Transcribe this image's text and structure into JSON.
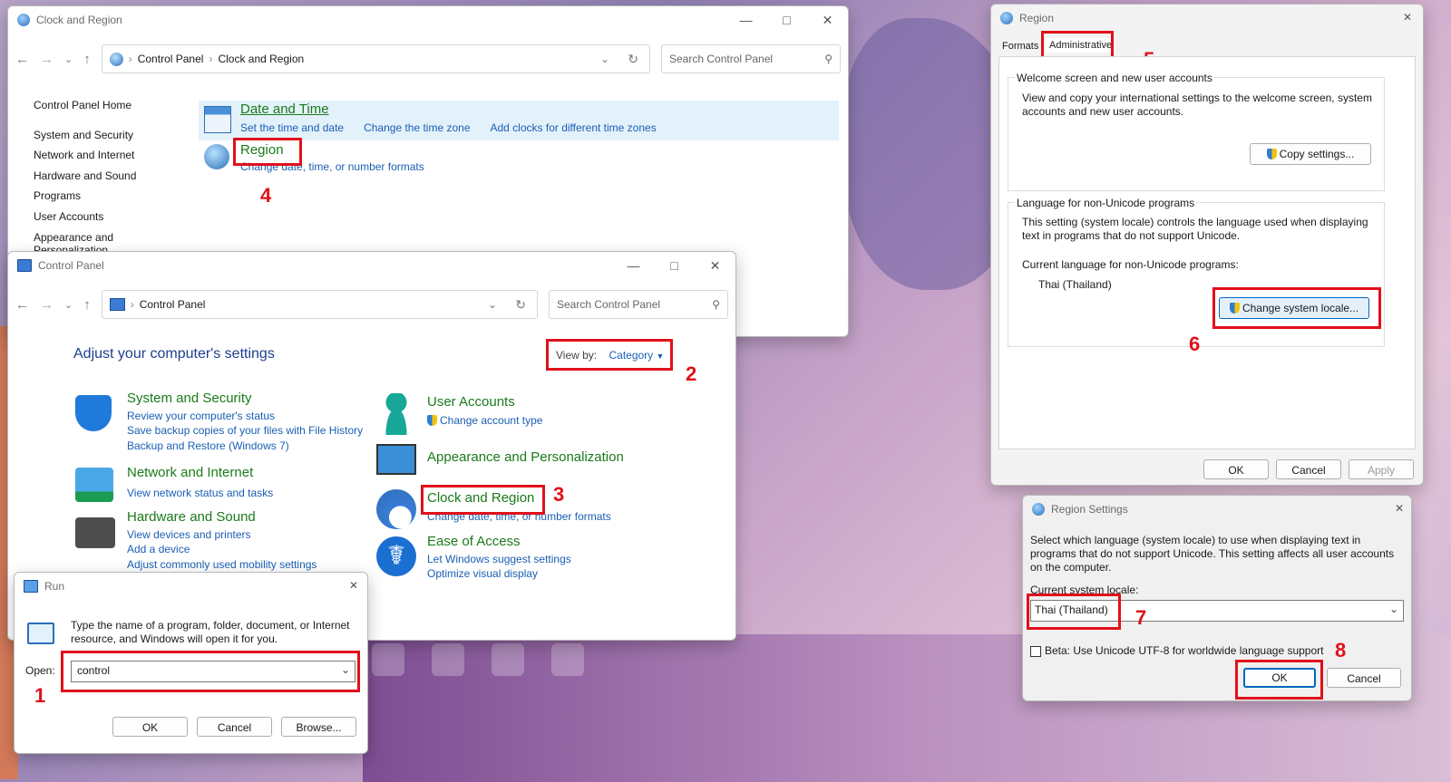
{
  "desktop": {},
  "clock_region_window": {
    "title": "Clock and Region",
    "breadcrumb": [
      "Control Panel",
      "Clock and Region"
    ],
    "search_placeholder": "Search Control Panel",
    "nav": [
      "Control Panel Home",
      "System and Security",
      "Network and Internet",
      "Hardware and Sound",
      "Programs",
      "User Accounts",
      "Appearance and",
      "Personalization"
    ],
    "date_time": {
      "title": "Date and Time",
      "links": [
        "Set the time and date",
        "Change the time zone",
        "Add clocks for different time zones"
      ]
    },
    "region": {
      "title": "Region",
      "link": "Change date, time, or number formats"
    },
    "step": "4"
  },
  "control_panel_window": {
    "title": "Control Panel",
    "breadcrumb": "Control Panel",
    "search_placeholder": "Search Control Panel",
    "heading": "Adjust your computer's settings",
    "view_by_label": "View by:",
    "view_by_value": "Category",
    "step_view": "2",
    "step_clock": "3",
    "left": [
      {
        "title": "System and Security",
        "links": [
          "Review your computer's status",
          "Save backup copies of your files with File History",
          "Backup and Restore (Windows 7)"
        ]
      },
      {
        "title": "Network and Internet",
        "links": [
          "View network status and tasks"
        ]
      },
      {
        "title": "Hardware and Sound",
        "links": [
          "View devices and printers",
          "Add a device",
          "Adjust commonly used mobility settings"
        ]
      }
    ],
    "right": [
      {
        "title": "User Accounts",
        "links": [
          "Change account type"
        ]
      },
      {
        "title": "Appearance and Personalization",
        "links": []
      },
      {
        "title": "Clock and Region",
        "links": [
          "Change date, time, or number formats"
        ]
      },
      {
        "title": "Ease of Access",
        "links": [
          "Let Windows suggest settings",
          "Optimize visual display"
        ]
      }
    ]
  },
  "run_dialog": {
    "title": "Run",
    "description": "Type the name of a program, folder, document, or Internet resource, and Windows will open it for you.",
    "open_label": "Open:",
    "open_value": "control",
    "ok": "OK",
    "cancel": "Cancel",
    "browse": "Browse...",
    "step": "1"
  },
  "region_dialog": {
    "title": "Region",
    "tabs": [
      "Formats",
      "Administrative"
    ],
    "step_tab": "5",
    "welcome_group": "Welcome screen and new user accounts",
    "welcome_text": "View and copy your international settings to the welcome screen, system accounts and new user accounts.",
    "copy_button": "Copy settings...",
    "nonunicode_group": "Language for non-Unicode programs",
    "nonunicode_text": "This setting (system locale) controls the language used when displaying text in programs that do not support Unicode.",
    "current_label": "Current language for non-Unicode programs:",
    "current_value": "Thai (Thailand)",
    "change_button": "Change system locale...",
    "step_change": "6",
    "ok": "OK",
    "cancel": "Cancel",
    "apply": "Apply"
  },
  "region_settings_dialog": {
    "title": "Region Settings",
    "description": "Select which language (system locale) to use when displaying text in programs that do not support Unicode. This setting affects all user accounts on the computer.",
    "locale_label": "Current system locale:",
    "locale_value": "Thai (Thailand)",
    "step_locale": "7",
    "beta_label": "Beta: Use Unicode UTF-8 for worldwide language support",
    "ok": "OK",
    "cancel": "Cancel",
    "step_ok": "8"
  }
}
